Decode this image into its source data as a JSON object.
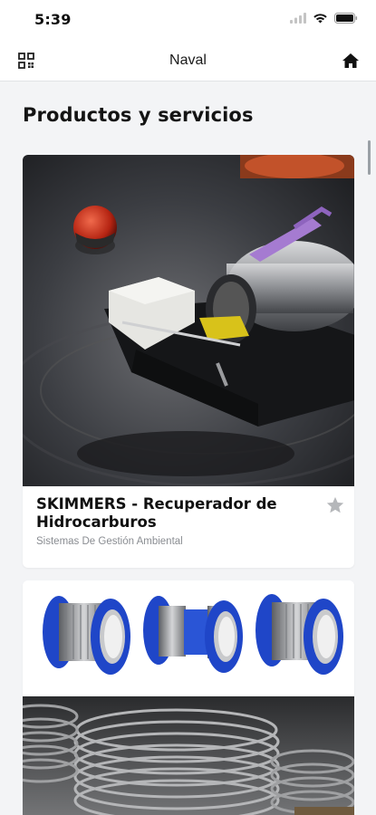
{
  "status_bar": {
    "time": "5:39"
  },
  "nav": {
    "title": "Naval",
    "left_icon": "qr-code-icon",
    "right_icon": "home-icon"
  },
  "section": {
    "title": "Productos y servicios"
  },
  "products": [
    {
      "title": "SKIMMERS - Recuperador de Hidrocarburos",
      "category": "Sistemas De Gestión Ambiental",
      "favorite_icon": "star-icon",
      "image": "oil-skimmer-photo"
    },
    {
      "image": "expansion-joints-photo"
    }
  ],
  "colors": {
    "accent_blue": "#1f46c8",
    "background": "#f3f4f6"
  }
}
